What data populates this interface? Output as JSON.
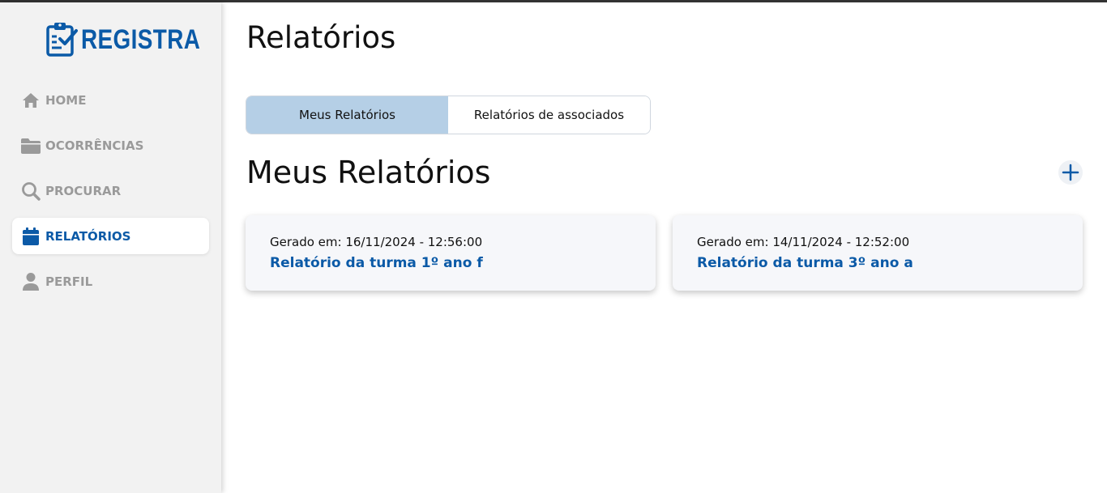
{
  "app": {
    "logo_text": "REGISTRA",
    "brand_color": "#0b5aa7"
  },
  "sidebar": {
    "items": [
      {
        "label": "HOME",
        "icon": "home-icon",
        "active": false
      },
      {
        "label": "OCORRÊNCIAS",
        "icon": "folder-icon",
        "active": false
      },
      {
        "label": "PROCURAR",
        "icon": "search-icon",
        "active": false
      },
      {
        "label": "RELATÓRIOS",
        "icon": "calendar-icon",
        "active": true
      },
      {
        "label": "PERFIL",
        "icon": "user-icon",
        "active": false
      }
    ]
  },
  "main": {
    "page_title": "Relatórios",
    "tabs": [
      {
        "label": "Meus Relatórios",
        "active": true
      },
      {
        "label": "Relatórios de associados",
        "active": false
      }
    ],
    "section_title": "Meus Relatórios",
    "add_icon": "plus-icon",
    "reports": [
      {
        "date": "Gerado em: 16/11/2024 - 12:56:00",
        "title": "Relatório da turma 1º ano f"
      },
      {
        "date": "Gerado em: 14/11/2024 - 12:52:00",
        "title": "Relatório da turma 3º ano a"
      }
    ]
  }
}
